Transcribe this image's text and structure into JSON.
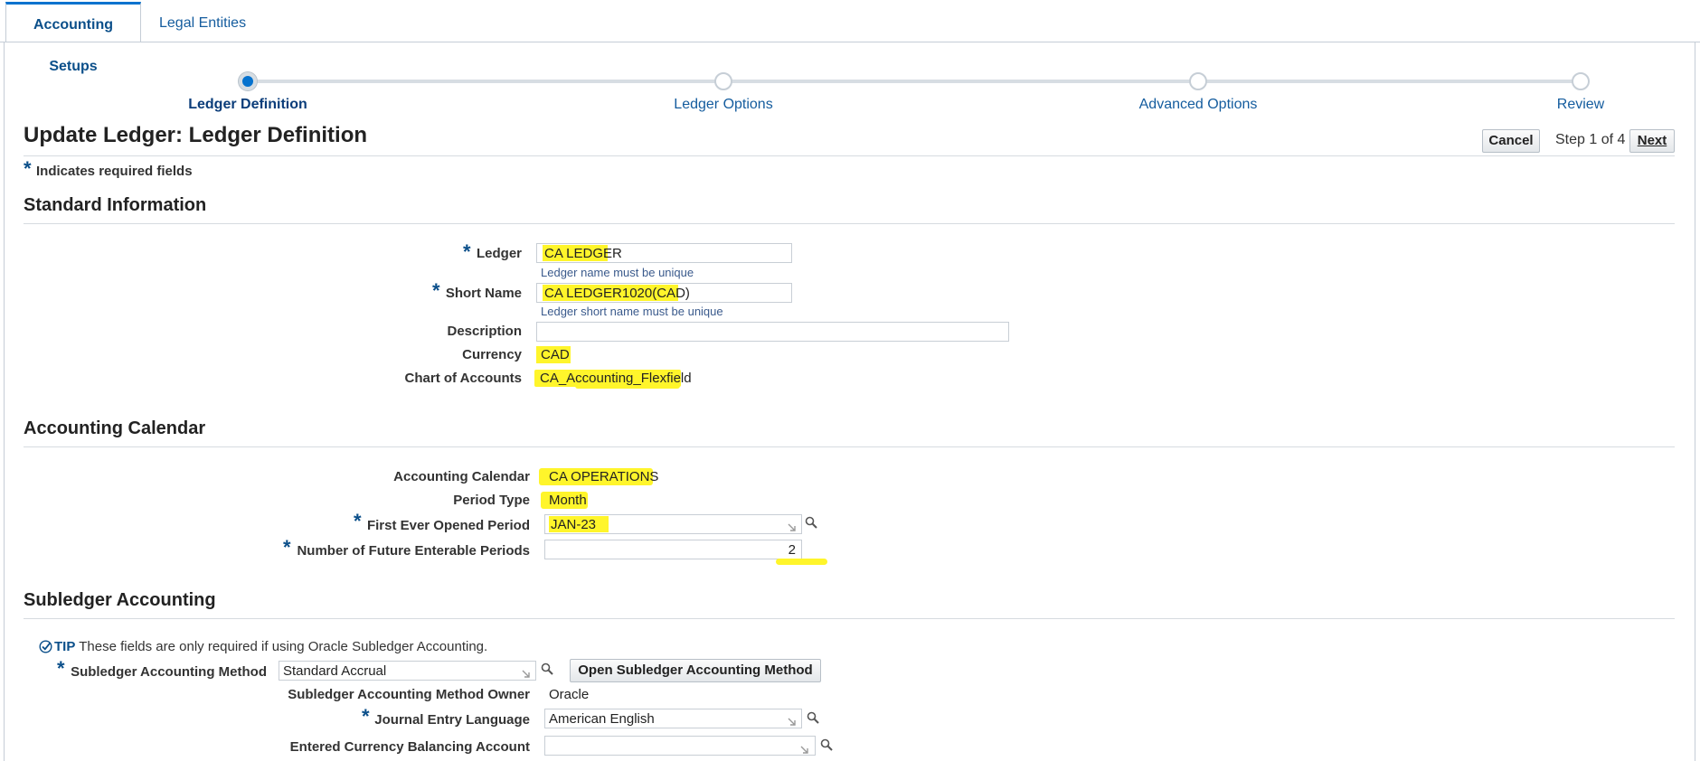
{
  "tabs": [
    {
      "label": "Accounting Setups",
      "active": true
    },
    {
      "label": "Legal Entities",
      "active": false
    }
  ],
  "train": {
    "steps": [
      "Ledger Definition",
      "Ledger Options",
      "Advanced Options",
      "Review"
    ],
    "current_index": 0
  },
  "header": {
    "title": "Update Ledger: Ledger Definition",
    "cancel_label": "Cancel",
    "step_text": "Step 1 of 4",
    "next_label": "Next"
  },
  "required_note": "Indicates required fields",
  "required_star": "*",
  "standard_info": {
    "section_title": "Standard Information",
    "ledger_label": "Ledger",
    "ledger_value": "CA LEDGER",
    "ledger_hint": "Ledger name must be unique",
    "short_name_label": "Short Name",
    "short_name_value": "CA LEDGER1020(CAD)",
    "short_name_hint": "Ledger short name must be unique",
    "description_label": "Description",
    "description_value": "",
    "currency_label": "Currency",
    "currency_value": "CAD",
    "coa_label": "Chart of Accounts",
    "coa_value": "CA_Accounting_Flexfield"
  },
  "accounting_calendar": {
    "section_title": "Accounting Calendar",
    "calendar_label": "Accounting Calendar",
    "calendar_value": "CA OPERATIONS",
    "period_type_label": "Period Type",
    "period_type_value": "Month",
    "first_period_label": "First Ever Opened Period",
    "first_period_value": "JAN-23",
    "future_periods_label": "Number of Future Enterable Periods",
    "future_periods_value": "2"
  },
  "subledger": {
    "section_title": "Subledger Accounting",
    "tip_label": "TIP",
    "tip_text": "These fields are only required if using Oracle Subledger Accounting.",
    "method_label": "Subledger Accounting Method",
    "method_value": "Standard Accrual",
    "open_method_button": "Open Subledger Accounting Method",
    "owner_label": "Subledger Accounting Method Owner",
    "owner_value": "Oracle",
    "language_label": "Journal Entry Language",
    "language_value": "American English",
    "balancing_label": "Entered Currency Balancing Account",
    "balancing_value": ""
  },
  "colors": {
    "accent": "#0572ce",
    "highlight": "#fff52b",
    "link": "#145c9e"
  }
}
